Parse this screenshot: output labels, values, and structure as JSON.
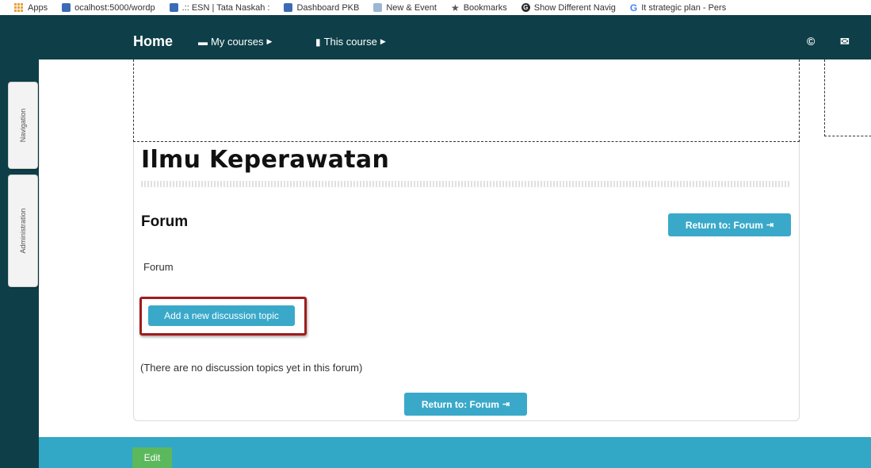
{
  "bookmarks": [
    {
      "label": "Apps",
      "icon": "apps-grid-icon"
    },
    {
      "label": "ocalhost:5000/wordp",
      "icon": "site-favicon-icon"
    },
    {
      "label": ".:: ESN | Tata Naskah :",
      "icon": "site-favicon-icon"
    },
    {
      "label": "Dashboard PKB",
      "icon": "site-favicon-icon"
    },
    {
      "label": "New & Event",
      "icon": "site-favicon-icon"
    },
    {
      "label": "Bookmarks",
      "icon": "star-icon"
    },
    {
      "label": "Show Different Navig",
      "icon": "g-favicon-icon"
    },
    {
      "label": "It strategic plan - Pers",
      "icon": "google-icon"
    }
  ],
  "navbar": {
    "home": "Home",
    "my_courses": "My courses",
    "this_course": "This course",
    "icons": [
      "user-circle-icon",
      "envelope-icon"
    ]
  },
  "side_tabs": {
    "navigation": "Navigation",
    "administration": "Administration"
  },
  "main": {
    "course_title": "Ilmu Keperawatan",
    "forum_heading": "Forum",
    "return_button_top": "Return to: Forum",
    "forum_description": "Forum",
    "add_topic_button": "Add a new discussion topic",
    "no_topics_text": "(There are no discussion topics yet in this forum)",
    "return_button_bottom": "Return to: Forum"
  },
  "footer": {
    "edit_button": "Edit"
  },
  "colors": {
    "frame_dark": "#0e3f48",
    "footer_band": "#32a7c6",
    "button_primary": "#3aa9c9",
    "edit_green": "#5cb85c",
    "highlight_red": "#a01c1c"
  }
}
